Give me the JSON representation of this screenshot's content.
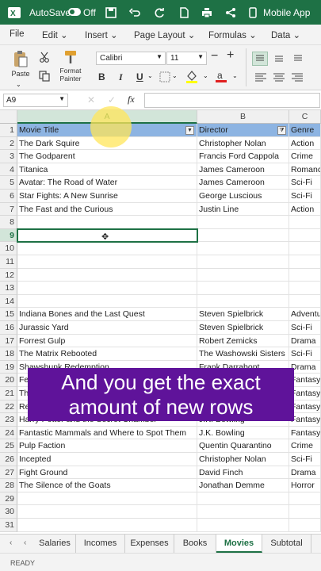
{
  "titlebar": {
    "autosave_label": "AutoSave",
    "toggle_state": "Off",
    "mobile_app_label": "Mobile App"
  },
  "menu": [
    "File",
    "Edit",
    "Insert",
    "Page Layout",
    "Formulas",
    "Data"
  ],
  "ribbon": {
    "paste_label": "Paste",
    "format_painter_label": "Format Painter",
    "font_name": "Calibri",
    "font_size": "11",
    "bold": "B",
    "italic": "I",
    "underline": "U"
  },
  "formula_bar": {
    "name_box": "A9",
    "fx": "fx",
    "content": ""
  },
  "columns": [
    "A",
    "B",
    "C"
  ],
  "headers": [
    "Movie Title",
    "Director",
    "Genre"
  ],
  "rows": [
    {
      "n": "1",
      "a": "Movie Title",
      "b": "Director",
      "c": "Genre"
    },
    {
      "n": "2",
      "a": "The Dark Squire",
      "b": "Christopher Nolan",
      "c": "Action"
    },
    {
      "n": "3",
      "a": "The Godparent",
      "b": "Francis Ford Cappola",
      "c": "Crime"
    },
    {
      "n": "4",
      "a": "Titanica",
      "b": "James Cameroon",
      "c": "Romance"
    },
    {
      "n": "5",
      "a": "Avatar: The Road of Water",
      "b": "James Cameroon",
      "c": "Sci-Fi"
    },
    {
      "n": "6",
      "a": "Star Fights: A New Sunrise",
      "b": "George Luscious",
      "c": "Sci-Fi"
    },
    {
      "n": "7",
      "a": "The Fast and the Curious",
      "b": "Justin Line",
      "c": "Action"
    },
    {
      "n": "8",
      "a": "",
      "b": "",
      "c": ""
    },
    {
      "n": "9",
      "a": "",
      "b": "",
      "c": ""
    },
    {
      "n": "10",
      "a": "",
      "b": "",
      "c": ""
    },
    {
      "n": "11",
      "a": "",
      "b": "",
      "c": ""
    },
    {
      "n": "12",
      "a": "",
      "b": "",
      "c": ""
    },
    {
      "n": "13",
      "a": "",
      "b": "",
      "c": ""
    },
    {
      "n": "14",
      "a": "",
      "b": "",
      "c": ""
    },
    {
      "n": "15",
      "a": "Indiana Bones and the Last Quest",
      "b": "Steven Spielbrick",
      "c": "Adventure"
    },
    {
      "n": "16",
      "a": "Jurassic Yard",
      "b": "Steven Spielbrick",
      "c": "Sci-Fi"
    },
    {
      "n": "17",
      "a": "Forrest Gulp",
      "b": "Robert Zemicks",
      "c": "Drama"
    },
    {
      "n": "18",
      "a": "The Matrix Rebooted",
      "b": "The Washowski Sisters",
      "c": "Sci-Fi"
    },
    {
      "n": "19",
      "a": "Shawshunk Redemption",
      "b": "Frank Darrabont",
      "c": "Drama"
    },
    {
      "n": "20",
      "a": "Fe",
      "b": "",
      "c": "Fantasy"
    },
    {
      "n": "21",
      "a": "Th",
      "b": "",
      "c": "Fantasy"
    },
    {
      "n": "22",
      "a": "Retu",
      "b": "",
      "c": "Fantasy"
    },
    {
      "n": "23",
      "a": "Harry Potter and the Secret Chamber",
      "b": "J.K. Bowling",
      "c": "Fantasy"
    },
    {
      "n": "24",
      "a": "Fantastic Mammals and Where to Spot Them",
      "b": "J.K. Bowling",
      "c": "Fantasy"
    },
    {
      "n": "25",
      "a": "Pulp Faction",
      "b": "Quentin Quarantino",
      "c": "Crime"
    },
    {
      "n": "26",
      "a": "Incepted",
      "b": "Christopher Nolan",
      "c": "Sci-Fi"
    },
    {
      "n": "27",
      "a": "Fight Ground",
      "b": "David Finch",
      "c": "Drama"
    },
    {
      "n": "28",
      "a": "The Silence of the Goats",
      "b": "Jonathan Demme",
      "c": "Horror"
    },
    {
      "n": "29",
      "a": "",
      "b": "",
      "c": ""
    },
    {
      "n": "30",
      "a": "",
      "b": "",
      "c": ""
    },
    {
      "n": "31",
      "a": "",
      "b": "",
      "c": ""
    }
  ],
  "caption": {
    "line1": "And you get the exact",
    "line2": "amount of new rows"
  },
  "sheet_tabs": [
    "Salaries",
    "Incomes",
    "Expenses",
    "Books",
    "Movies",
    "Subtotal"
  ],
  "active_tab": "Movies",
  "status": "READY",
  "colors": {
    "brand": "#1e7145",
    "header_fill": "#8db4e2",
    "caption_bg": "#5f139a"
  }
}
